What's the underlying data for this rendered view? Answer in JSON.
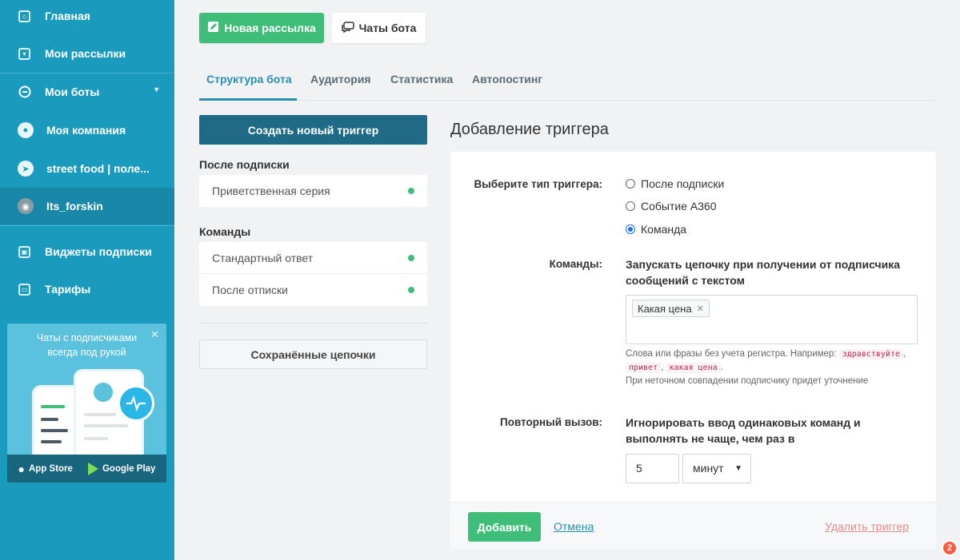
{
  "sidebar": {
    "items": [
      {
        "label": "Главная",
        "icon": "home-icon"
      },
      {
        "label": "Мои рассылки",
        "icon": "inbox-icon"
      },
      {
        "label": "Мои боты",
        "icon": "bot-icon"
      },
      {
        "label": "Моя компания",
        "icon": "company-avatar"
      },
      {
        "label": "street food | поле...",
        "icon": "telegram-icon"
      },
      {
        "label": "Its_forskin",
        "icon": "instagram-avatar"
      },
      {
        "label": "Виджеты подписки",
        "icon": "widget-icon"
      },
      {
        "label": "Тарифы",
        "icon": "tariff-icon"
      }
    ],
    "promo": {
      "text": "Чаты с подписчиками всегда под рукой",
      "close": "✕",
      "app_store": "App Store",
      "google_play": "Google Play"
    }
  },
  "toolbar": {
    "new_mailing": "Новая рассылка",
    "bot_chats": "Чаты бота"
  },
  "tabs": [
    "Структура бота",
    "Аудитория",
    "Статистика",
    "Автопостинг"
  ],
  "left": {
    "create_trigger": "Создать новый триггер",
    "groups": [
      {
        "title": "После подписки",
        "items": [
          "Приветственная серия"
        ]
      },
      {
        "title": "Команды",
        "items": [
          "Стандартный ответ",
          "После отписки"
        ]
      }
    ],
    "saved_chains": "Сохранённые цепочки"
  },
  "form": {
    "title": "Добавление триггера",
    "type_label": "Выберите тип триггера:",
    "options": [
      "После подписки",
      "Событие A360",
      "Команда"
    ],
    "selected_option": "Команда",
    "commands_label": "Команды:",
    "commands_desc": "Запускать цепочку при получении от подписчика сообщений с текстом",
    "tag": "Какая цена",
    "hint_prefix": "Слова или фразы без учета регистра. Например:",
    "hint_examples": [
      "здравствуйте",
      "привет",
      "какая цена"
    ],
    "hint_note": "При неточном совпадении подписчику придет уточнение",
    "repeat_label": "Повторный вызов:",
    "repeat_desc": "Игнорировать ввод одинаковых команд и выполнять не чаще, чем раз в",
    "repeat_value": "5",
    "repeat_unit": "минут",
    "add": "Добавить",
    "cancel": "Отмена",
    "delete": "Удалить триггер"
  },
  "badge": "2",
  "colors": {
    "sidebar": "#1a9bbd",
    "accent": "#2a8faf",
    "primary_green": "#3ebe78",
    "dark_button": "#1d6b86"
  }
}
